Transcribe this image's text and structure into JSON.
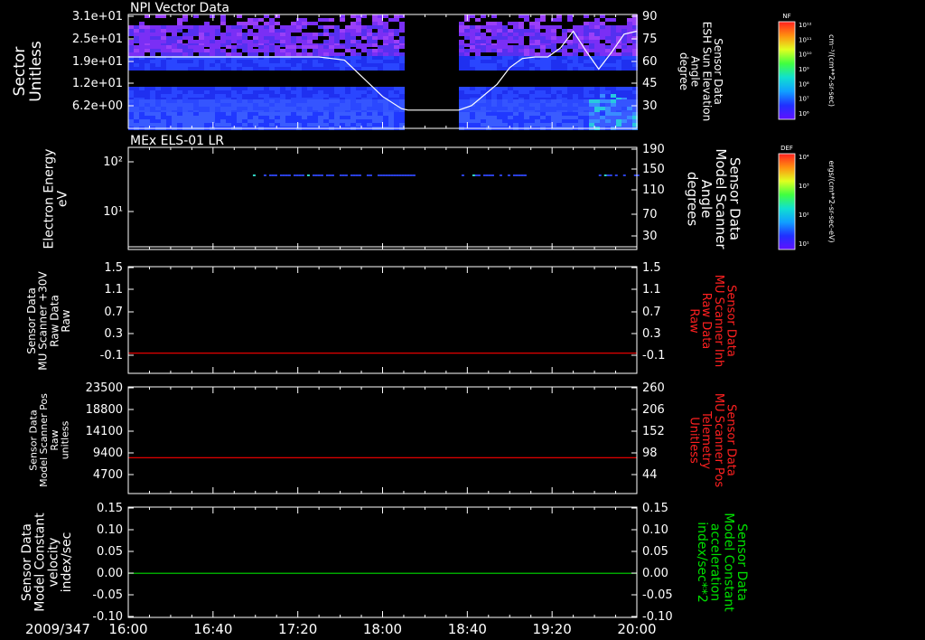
{
  "colors": {
    "background": "#000000",
    "axis": "#ffffff",
    "red_trace": "#ff0000",
    "green_trace": "#00dd00",
    "right_label_red": "#ff2020",
    "right_label_green": "#00e000"
  },
  "time_axis": {
    "date_label": "2009/347",
    "ticks": [
      "16:00",
      "16:40",
      "17:20",
      "18:00",
      "18:40",
      "19:20",
      "20:00"
    ],
    "range_hours": [
      16.0,
      20.0
    ]
  },
  "colorbars": [
    {
      "title": "NF",
      "units": "cm⁻³/(cm**2-sr-sec)",
      "tick_labels": [
        "10¹²",
        "10¹¹",
        "10¹⁰",
        "10⁹",
        "10⁸",
        "10⁷",
        "10⁶"
      ]
    },
    {
      "title": "DEF",
      "units": "ergs/(cm**2-sr-sec-eV)",
      "tick_labels": [
        "10⁴",
        "10³",
        "10²",
        "10¹"
      ]
    }
  ],
  "chart_data": [
    {
      "type": "heatmap",
      "title": "NPI Vector Data",
      "ylabel": "Sector Unitless",
      "y_tick_labels": [
        "3.1e+01",
        "2.5e+01",
        "1.9e+01",
        "1.2e+01",
        "6.2e+00"
      ],
      "ylim": [
        0,
        31
      ],
      "right_axis": {
        "label": "Sensor Data ESH Sun Elevation Angle degree",
        "tick_labels": [
          "90",
          "75",
          "60",
          "45",
          "30"
        ],
        "ylim": [
          15,
          90
        ]
      },
      "data_gap_hours": [
        18.17,
        18.6
      ],
      "overlay_line": {
        "x_hours": [
          16.0,
          17.5,
          17.7,
          17.8,
          18.0,
          18.15,
          18.2,
          18.6,
          18.7,
          18.9,
          19.0,
          19.1,
          19.2,
          19.3,
          19.4,
          19.5,
          19.6,
          19.7,
          19.8,
          19.9,
          20.0
        ],
        "y_deg": [
          62,
          62,
          60,
          52,
          36,
          28,
          27,
          27,
          30,
          44,
          55,
          61,
          62,
          62,
          68,
          79,
          66,
          54,
          65,
          77,
          79
        ]
      }
    },
    {
      "type": "heatmap",
      "title": "MEx ELS-01 LR",
      "ylabel": "Electron Energy eV",
      "y_tick_labels": [
        "10²",
        "10¹"
      ],
      "yscale": "log",
      "right_axis": {
        "label": "Sensor Data Model Scanner Angle degrees",
        "tick_labels": [
          "190",
          "150",
          "110",
          "70",
          "30"
        ],
        "ylim": [
          0,
          190
        ]
      },
      "overlay_line": {
        "x_hours": [
          16.0,
          20.0
        ],
        "y_deg": [
          5,
          5
        ]
      },
      "signal_band": {
        "energy_eV": 50,
        "x_hours": [
          [
            16.98,
            18.25
          ],
          [
            18.6,
            19.15
          ],
          [
            19.7,
            20.0
          ]
        ]
      }
    },
    {
      "type": "line",
      "ylabel": "Sensor Data MU Scanner +30V Raw Data Raw",
      "y_tick_labels": [
        "1.5",
        "1.1",
        "0.7",
        "0.3",
        "-0.1"
      ],
      "ylim": [
        -0.35,
        1.5
      ],
      "right_axis": {
        "label": "Sensor Data MU Scanner Inh Raw Data Raw",
        "tick_labels": [
          "1.5",
          "1.1",
          "0.7",
          "0.3",
          "-0.1"
        ]
      },
      "series": [
        {
          "x_hours": [
            16.0,
            20.0
          ],
          "values": [
            0.0,
            0.0
          ],
          "color": "#ff0000"
        }
      ]
    },
    {
      "type": "line",
      "ylabel": "Sensor Data Model Scanner Pos Raw unitless",
      "y_tick_labels": [
        "23500",
        "18800",
        "14100",
        "9400",
        "4700"
      ],
      "ylim": [
        0,
        23500
      ],
      "right_axis": {
        "label": "Sensor Data MU Scanner Pos Telemetry Unitless",
        "tick_labels": [
          "260",
          "206",
          "152",
          "98",
          "44"
        ],
        "ylim": [
          0,
          260
        ]
      },
      "series": [
        {
          "x_hours": [
            16.0,
            20.0
          ],
          "values": [
            7900,
            7900
          ],
          "color": "#ff0000"
        }
      ]
    },
    {
      "type": "line",
      "ylabel": "Sensor Data Model Constant velocity index/sec",
      "y_tick_labels": [
        "0.15",
        "0.10",
        "0.05",
        "0.00",
        "-0.05",
        "-0.10"
      ],
      "ylim": [
        -0.1,
        0.15
      ],
      "right_axis": {
        "label": "Sensor Data Model Constant acceleration index/sec**2",
        "tick_labels": [
          "0.15",
          "0.10",
          "0.05",
          "0.00",
          "-0.05",
          "-0.10"
        ]
      },
      "series": [
        {
          "x_hours": [
            16.0,
            20.0
          ],
          "values": [
            0.0,
            0.0
          ],
          "color": "#00dd00"
        }
      ]
    }
  ]
}
